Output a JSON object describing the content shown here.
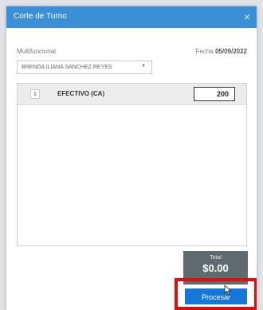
{
  "dialog": {
    "title": "Corte de Turno",
    "close_glyph": "×"
  },
  "form": {
    "multifuncional_label": "Multifuncional",
    "fecha_label": "Fecha",
    "fecha_value": "05/09/2022",
    "employee_selected": "BRENDA ILIANA SANCHEZ REYES"
  },
  "payments": [
    {
      "qty": "1",
      "method": "EFECTIVO (CA)",
      "amount": "200"
    }
  ],
  "summary": {
    "total_label": "Total",
    "total_value": "$0.00"
  },
  "actions": {
    "process_label": "Procesar"
  },
  "colors": {
    "titlebar": "#3b8fd6",
    "primary_button": "#1577d6",
    "highlight": "#e10d0d",
    "total_box": "#5f6a6f"
  }
}
